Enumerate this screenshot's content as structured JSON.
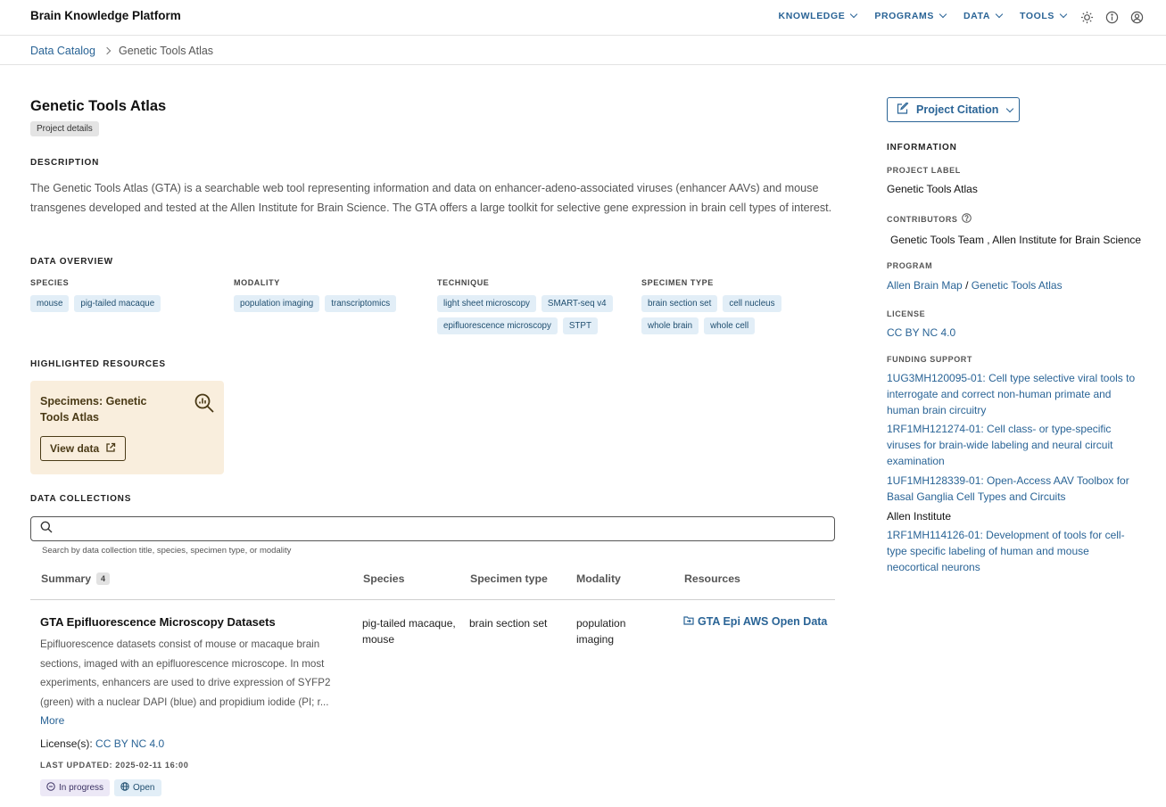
{
  "header": {
    "brand": "Brain Knowledge Platform",
    "nav": [
      {
        "label": "KNOWLEDGE"
      },
      {
        "label": "PROGRAMS"
      },
      {
        "label": "DATA"
      },
      {
        "label": "TOOLS"
      }
    ],
    "icons": [
      "theme-sun-icon",
      "info-icon",
      "user-account-icon"
    ]
  },
  "breadcrumb": {
    "root": "Data Catalog",
    "current": "Genetic Tools Atlas"
  },
  "project": {
    "title": "Genetic Tools Atlas",
    "chip": "Project details",
    "description_heading": "DESCRIPTION",
    "description": "The Genetic Tools Atlas (GTA) is a searchable web tool representing information and data on enhancer-adeno-associated viruses (enhancer AAVs) and mouse transgenes developed and tested at the Allen Institute for Brain Science. The GTA offers a large toolkit for selective gene expression in brain cell types of interest."
  },
  "overview": {
    "heading": "DATA OVERVIEW",
    "species": {
      "label": "SPECIES",
      "tags": [
        "mouse",
        "pig-tailed macaque"
      ]
    },
    "modality": {
      "label": "MODALITY",
      "tags": [
        "population imaging",
        "transcriptomics"
      ]
    },
    "technique": {
      "label": "TECHNIQUE",
      "tags": [
        "light sheet microscopy",
        "SMART-seq v4",
        "epifluorescence microscopy",
        "STPT"
      ]
    },
    "specimen_type": {
      "label": "SPECIMEN TYPE",
      "tags": [
        "brain section set",
        "cell nucleus",
        "whole brain",
        "whole cell"
      ]
    }
  },
  "highlighted": {
    "heading": "HIGHLIGHTED RESOURCES",
    "card_title": "Specimens: Genetic Tools Atlas",
    "button": "View data"
  },
  "collections": {
    "heading": "DATA COLLECTIONS",
    "search_placeholder": "",
    "search_help": "Search by data collection title, species, specimen type, or modality",
    "columns": {
      "summary": "Summary",
      "count": "4",
      "species": "Species",
      "specimen_type": "Specimen type",
      "modality": "Modality",
      "resources": "Resources"
    },
    "rows": [
      {
        "title": "GTA Epifluorescence Microscopy Datasets",
        "description": "Epifluorescence datasets consist of mouse or macaque brain sections, imaged with an epifluorescence microscope. In most experiments, enhancers are used to drive expression of SYFP2 (green) with a nuclear DAPI (blue) and propidium iodide (PI; r...",
        "more": "More",
        "license_label": "License(s):",
        "license": "CC BY NC 4.0",
        "updated": "LAST UPDATED: 2025-02-11 16:00",
        "status": "In progress",
        "access": "Open",
        "species": "pig-tailed macaque, mouse",
        "specimen_type": "brain section set",
        "modality": "population imaging",
        "resource": "GTA Epi AWS Open Data"
      }
    ]
  },
  "sidebar": {
    "citation_button": "Project Citation",
    "info_heading": "INFORMATION",
    "project_label_h": "PROJECT LABEL",
    "project_label": "Genetic Tools Atlas",
    "contributors_h": "CONTRIBUTORS",
    "contributors": "Genetic Tools Team , Allen Institute for Brain Science",
    "program_h": "PROGRAM",
    "program_a": "Allen Brain Map",
    "program_sep": "/",
    "program_b": "Genetic Tools Atlas",
    "license_h": "LICENSE",
    "license": "CC BY NC 4.0",
    "funding_h": "FUNDING SUPPORT",
    "funding": [
      "1UG3MH120095-01: Cell type selective viral tools to interrogate and correct non-human primate and human brain circuitry",
      "1RF1MH121274-01: Cell class- or type-specific viruses for brain-wide labeling and neural circuit examination",
      "1UF1MH128339-01: Open-Access AAV Toolbox for Basal Ganglia Cell Types and Circuits"
    ],
    "funding_org": "Allen Institute",
    "funding_extra": "1RF1MH114126-01: Development of tools for cell-type specific labeling of human and mouse neocortical neurons"
  },
  "colors": {
    "link": "#2a6496",
    "tag_bg": "#e2eef7",
    "highlight_card": "#f9eedd"
  }
}
